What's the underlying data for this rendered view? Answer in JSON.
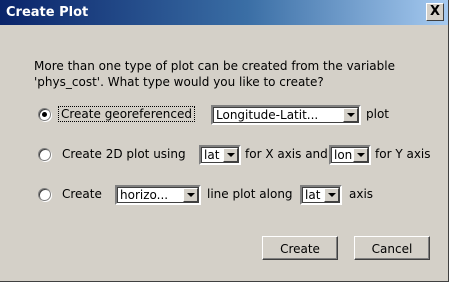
{
  "window": {
    "title": "Create Plot",
    "close_glyph": "X"
  },
  "prompt": {
    "line1": "More than one type of plot can be created from the variable",
    "line2": "'phys_cost'. What type would you like to create?"
  },
  "options": [
    {
      "selected": true,
      "label_before": "Create georeferenced",
      "combo_value": "Longitude-Latit...",
      "label_after": "plot"
    },
    {
      "selected": false,
      "label_before": "Create 2D plot using",
      "combo1_value": "lat",
      "label_middle": "for X axis and",
      "combo2_value": "lon",
      "label_after": "for Y axis"
    },
    {
      "selected": false,
      "label_before": "Create",
      "combo_value": "horizo...",
      "label_middle": "line plot along",
      "combo2_value": "lat",
      "label_after": "axis"
    }
  ],
  "buttons": {
    "create": "Create",
    "cancel": "Cancel"
  }
}
